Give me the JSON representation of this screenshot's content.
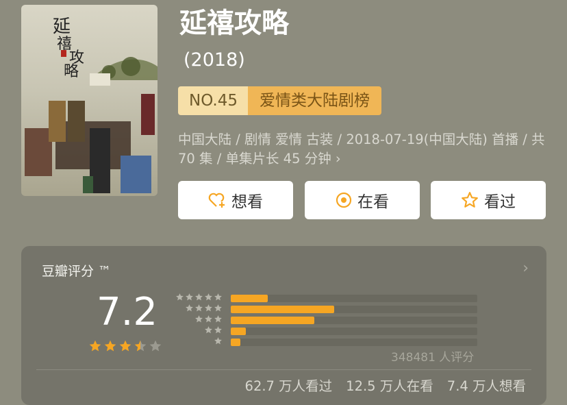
{
  "title": "延禧攻略",
  "year": "(2018)",
  "rank": {
    "number": "NO.45",
    "list": "爱情类大陆剧榜"
  },
  "meta": "中国大陆 / 剧情 爱情 古装 / 2018-07-19(中国大陆) 首播 / 共 70 集 / 单集片长 45 分钟 ›",
  "buttons": {
    "want": "想看",
    "watching": "在看",
    "watched": "看过"
  },
  "rating": {
    "label": "豆瓣评分 ™",
    "score": "7.2",
    "stars_filled": 3.5,
    "distribution": [
      {
        "stars": 5,
        "share": 0.15
      },
      {
        "stars": 4,
        "share": 0.42
      },
      {
        "stars": 3,
        "share": 0.34
      },
      {
        "stars": 2,
        "share": 0.06
      },
      {
        "stars": 1,
        "share": 0.04
      }
    ],
    "count": "348481 人评分",
    "more_icon": "chevron-right-icon"
  },
  "stats": {
    "watched": "62.7 万人看过",
    "watching": "12.5 万人在看",
    "want": "7.4 万人想看"
  },
  "poster": {
    "calligraphy": "延禧攻略",
    "icon": "poster-image"
  },
  "colors": {
    "accent": "#f6a623",
    "rank_badge": "#f6dfa8",
    "rank_list": "#f0b656"
  }
}
